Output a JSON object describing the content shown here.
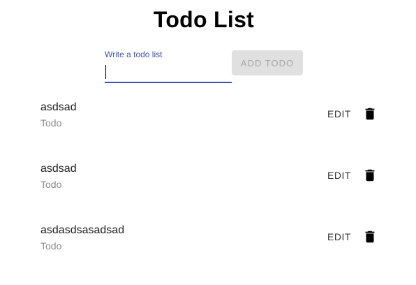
{
  "header": {
    "title": "Todo List"
  },
  "form": {
    "input_label": "Write a todo list",
    "input_value": "",
    "add_button_label": "ADD TODO"
  },
  "todos": [
    {
      "text": "asdsad",
      "status": "Todo",
      "edit_label": "EDIT",
      "delete_icon": "trash-icon"
    },
    {
      "text": "asdsad",
      "status": "Todo",
      "edit_label": "EDIT",
      "delete_icon": "trash-icon"
    },
    {
      "text": "asdasdsasadsad",
      "status": "Todo",
      "edit_label": "EDIT",
      "delete_icon": "trash-icon"
    }
  ],
  "colors": {
    "accent": "#3f51b5",
    "disabled_button_bg": "#e0e0e0",
    "disabled_button_text": "#a6a6a6",
    "secondary_text": "#8a8a8a"
  }
}
